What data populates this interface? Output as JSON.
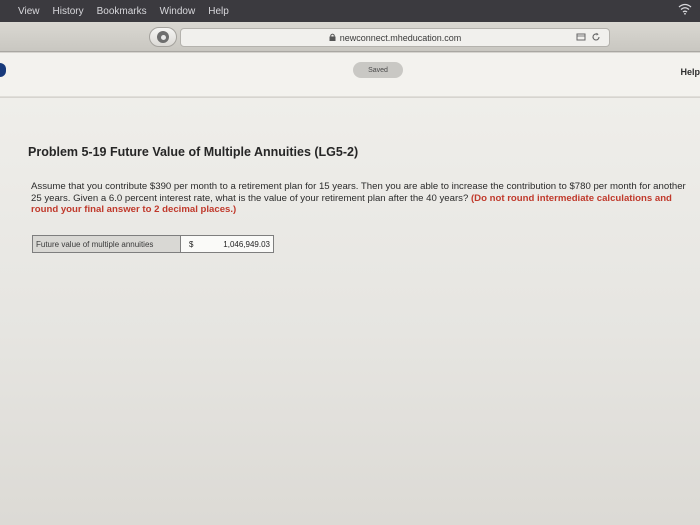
{
  "menubar": {
    "items": [
      "View",
      "History",
      "Bookmarks",
      "Window",
      "Help"
    ]
  },
  "browser": {
    "url": "newconnect.mheducation.com"
  },
  "header": {
    "saved_label": "Saved",
    "help_label": "Help"
  },
  "problem": {
    "title": "Problem 5-19 Future Value of Multiple Annuities (LG5-2)",
    "body": "Assume that you contribute $390 per month to a retirement plan for 15 years. Then you are able to increase the contribution to $780 per month for another 25 years. Given a 6.0 percent interest rate, what is the value of your retirement plan after the 40 years?",
    "instruction": "(Do not round intermediate calculations and round your final answer to 2 decimal places.)"
  },
  "answer": {
    "label": "Future value of multiple annuities",
    "currency": "$",
    "value": "1,046,949.03"
  }
}
